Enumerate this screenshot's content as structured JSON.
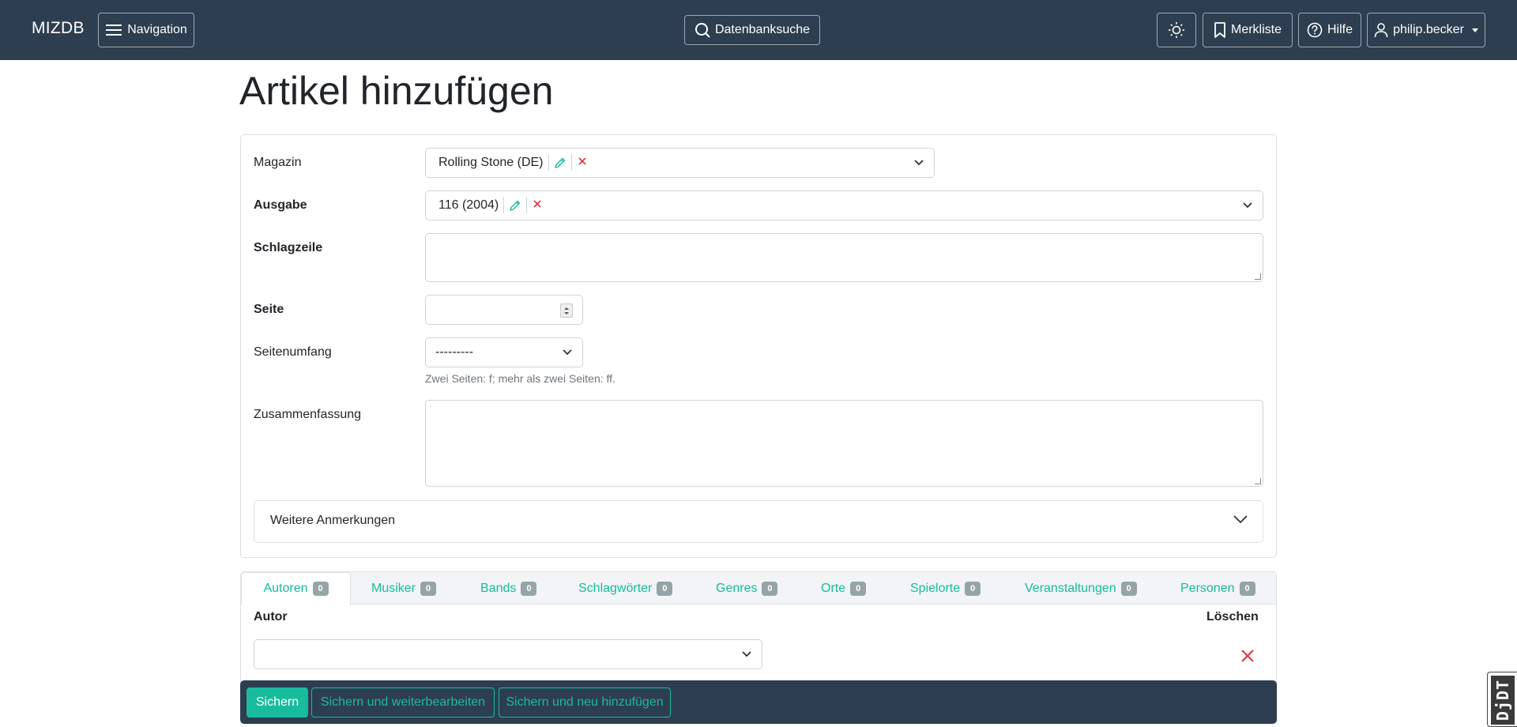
{
  "navbar": {
    "brand": "MIZDB",
    "navigation_label": "Navigation",
    "search_label": "Datenbanksuche",
    "merkliste_label": "Merkliste",
    "hilfe_label": "Hilfe",
    "user_label": "philip.becker"
  },
  "page": {
    "title": "Artikel hinzufügen"
  },
  "form": {
    "magazin": {
      "label": "Magazin",
      "value": "Rolling Stone (DE)"
    },
    "ausgabe": {
      "label": "Ausgabe",
      "value": "116 (2004)"
    },
    "schlagzeile": {
      "label": "Schlagzeile",
      "value": ""
    },
    "seite": {
      "label": "Seite",
      "value": ""
    },
    "seitenumfang": {
      "label": "Seitenumfang",
      "value": "---------",
      "help": "Zwei Seiten: f; mehr als zwei Seiten: ff."
    },
    "zusammenfassung": {
      "label": "Zusammenfassung",
      "value": ""
    },
    "weitere_anmerkungen": "Weitere Anmerkungen"
  },
  "tabs": [
    {
      "label": "Autoren",
      "count": "0"
    },
    {
      "label": "Musiker",
      "count": "0"
    },
    {
      "label": "Bands",
      "count": "0"
    },
    {
      "label": "Schlagwörter",
      "count": "0"
    },
    {
      "label": "Genres",
      "count": "0"
    },
    {
      "label": "Orte",
      "count": "0"
    },
    {
      "label": "Spielorte",
      "count": "0"
    },
    {
      "label": "Veranstaltungen",
      "count": "0"
    },
    {
      "label": "Personen",
      "count": "0"
    }
  ],
  "inline": {
    "col_autor": "Autor",
    "col_loeschen": "Löschen"
  },
  "submit": {
    "save": "Sichern",
    "save_continue": "Sichern und weiterbearbeiten",
    "save_add": "Sichern und neu hinzufügen"
  },
  "debug_toolbar": "DjDT",
  "colors": {
    "navbar": "#2c3e50",
    "accent": "#18bc9c",
    "danger": "#dc3545",
    "badge": "#95a5a6"
  },
  "icons": {
    "navigation": "hamburger-icon",
    "search": "magnifier-icon",
    "theme": "sun-icon",
    "merkliste": "bookmark-icon",
    "hilfe": "question-circle-icon",
    "user": "person-icon"
  }
}
